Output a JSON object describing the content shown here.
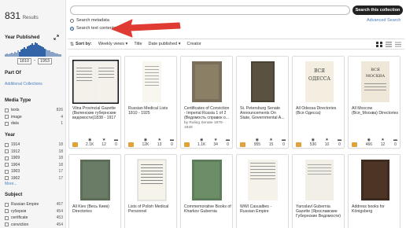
{
  "results": {
    "count": "831",
    "label": "Results"
  },
  "sidebar": {
    "year_published": {
      "title": "Year Published",
      "from": "1810",
      "to": "1953",
      "histogram": [
        2,
        3,
        2,
        3,
        4,
        3,
        5,
        4,
        6,
        5,
        7,
        8,
        9,
        8,
        10,
        11,
        12,
        13,
        12,
        14,
        13,
        12,
        11,
        10,
        9,
        8,
        7,
        6,
        6,
        5,
        5,
        4,
        3,
        3,
        2,
        2
      ]
    },
    "part_of": {
      "title": "Part Of",
      "link": "Additional Collections"
    },
    "media_type": {
      "title": "Media Type",
      "items": [
        {
          "name": "texts",
          "count": "826"
        },
        {
          "name": "image",
          "count": "4"
        },
        {
          "name": "data",
          "count": "1"
        }
      ]
    },
    "year": {
      "title": "Year",
      "items": [
        {
          "name": "1914",
          "count": "18"
        },
        {
          "name": "1912",
          "count": "18"
        },
        {
          "name": "1909",
          "count": "18"
        },
        {
          "name": "1904",
          "count": "18"
        },
        {
          "name": "1903",
          "count": "17"
        },
        {
          "name": "1902",
          "count": "17"
        }
      ],
      "more": "More..."
    },
    "subject": {
      "title": "Subject",
      "items": [
        {
          "name": "Russian Empire",
          "count": "457"
        },
        {
          "name": "губернія",
          "count": "454"
        },
        {
          "name": "certificate",
          "count": "453"
        },
        {
          "name": "conviction",
          "count": "454"
        }
      ]
    }
  },
  "search": {
    "placeholder": "",
    "button": "Search this collection",
    "advanced": "Advanced Search",
    "option_metadata": "Search metadata",
    "option_text": "Search text contents"
  },
  "sortbar": {
    "label": "Sort by:",
    "options": [
      "Weekly views",
      "Title",
      "Date published",
      "Creator"
    ]
  },
  "tiles": [
    {
      "title": "Vilna Provincial Gazette (Виленские губернские ведомости)1838 - 1917",
      "by": "",
      "views": "2.1K",
      "favs": "12",
      "reviews": "0"
    },
    {
      "title": "Russian Medical Lists 1810 - 1925",
      "by": "",
      "views": "12K",
      "favs": "13",
      "reviews": "0"
    },
    {
      "title": "Certificates of Conviction - Imperial Russia 1 of 2 (Ведомость справок о...",
      "by": "by Ruling Senate 1870-1929",
      "views": "1.1K",
      "favs": "34",
      "reviews": "0"
    },
    {
      "title": "St. Petersburg Senate Announcements On State, Governmental A...",
      "by": "",
      "views": "955",
      "favs": "15",
      "reviews": "0"
    },
    {
      "title": "All Odessa Directories (Вся Одесса)",
      "by": "",
      "views": "536",
      "favs": "10",
      "reviews": "0"
    },
    {
      "title": "All Moscow (Вся_Москва) Directories",
      "by": "",
      "views": "466",
      "favs": "12",
      "reviews": "0"
    },
    {
      "title": "All Kiev (Весь Киев) Directories",
      "by": "",
      "views": "",
      "favs": "",
      "reviews": ""
    },
    {
      "title": "Lists of Polish Medical Personnel",
      "by": "",
      "views": "",
      "favs": "",
      "reviews": ""
    },
    {
      "title": "Commemorative Books of Kharkov Gubernia",
      "by": "",
      "views": "",
      "favs": "",
      "reviews": ""
    },
    {
      "title": "WWI Casualties - Russian Empire",
      "by": "",
      "views": "",
      "favs": "",
      "reviews": ""
    },
    {
      "title": "Yaroslavl Gubernia Gazette (Ярославские Губернские Ведомости)",
      "by": "",
      "views": "",
      "favs": "",
      "reviews": ""
    },
    {
      "title": "Address books for Königsberg",
      "by": "",
      "views": "",
      "favs": "",
      "reviews": ""
    }
  ],
  "colors": {
    "accent": "#2b5da0",
    "arrow": "#e03b33",
    "media": "#e0a23a"
  }
}
